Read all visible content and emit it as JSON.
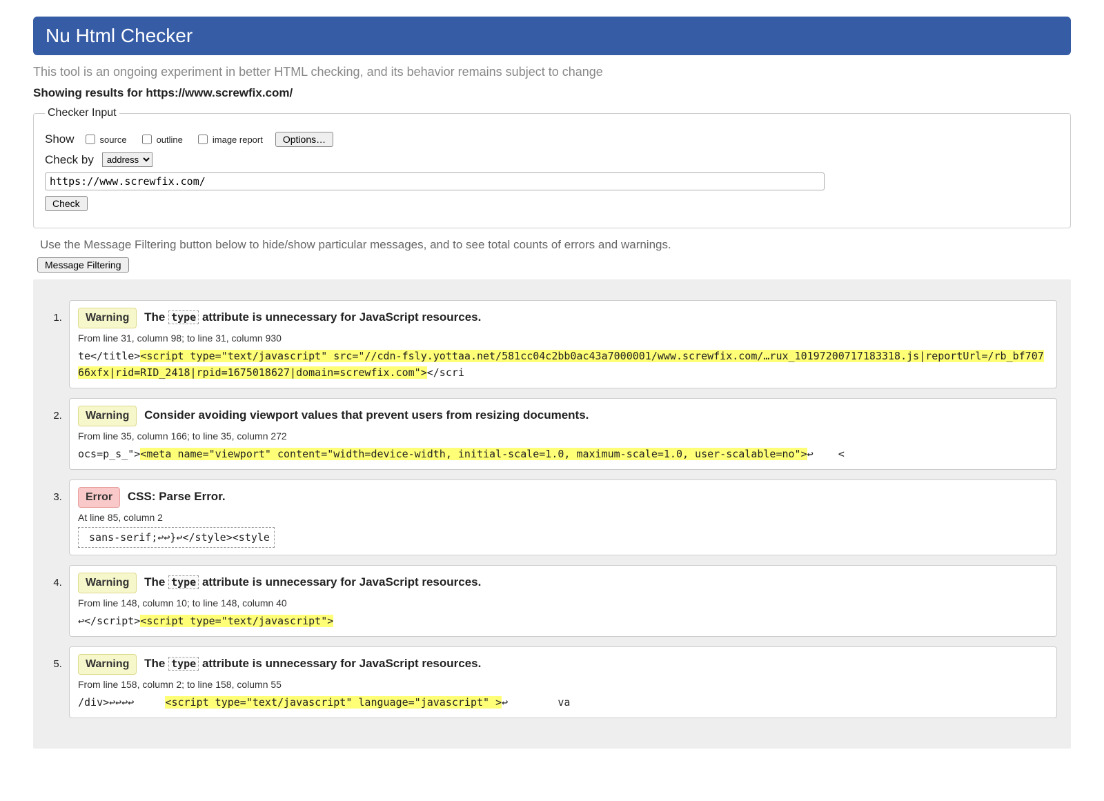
{
  "header": {
    "title": "Nu Html Checker"
  },
  "subtitle": "This tool is an ongoing experiment in better HTML checking, and its behavior remains subject to change",
  "showing_results_prefix": "Showing results for ",
  "showing_results_url": "https://www.screwfix.com/",
  "checker_input": {
    "legend": "Checker Input",
    "show_label": "Show",
    "cb_source": "source",
    "cb_outline": "outline",
    "cb_image_report": "image report",
    "options_btn": "Options…",
    "check_by_label": "Check by",
    "check_by_selected": "address",
    "url_value": "https://www.screwfix.com/",
    "check_btn": "Check"
  },
  "filter_note": "Use the Message Filtering button below to hide/show particular messages, and to see total counts of errors and warnings.",
  "message_filtering_btn": "Message Filtering",
  "badges": {
    "warning": "Warning",
    "error": "Error"
  },
  "messages": [
    {
      "type": "warning",
      "text_before_attr": "The ",
      "attr": "type",
      "text_after_attr": " attribute is unnecessary for JavaScript resources.",
      "location": "From line 31, column 98; to line 31, column 930",
      "extract_pre": "te</title>",
      "extract_hilite": "<script type=\"text/javascript\" src=\"//cdn-fsly.yottaa.net/581cc04c2bb0ac43a7000001/www.screwfix.com/…rux_10197200717183318.js|reportUrl=/rb_bf70766xfx|rid=RID_2418|rpid=1675018627|domain=screwfix.com\">",
      "extract_post": "</scri"
    },
    {
      "type": "warning",
      "text_plain": "Consider avoiding viewport values that prevent users from resizing documents.",
      "location": "From line 35, column 166; to line 35, column 272",
      "extract_pre": "ocs=p_s_\">",
      "extract_hilite": "<meta name=\"viewport\" content=\"width=device-width, initial-scale=1.0, maximum-scale=1.0, user-scalable=no\">",
      "extract_post": "↩    <"
    },
    {
      "type": "error",
      "text_plain": "CSS: Parse Error.",
      "location": "At line 85, column 2",
      "extract_boxed": " sans-serif;↩↩}↩</style><style"
    },
    {
      "type": "warning",
      "text_before_attr": "The ",
      "attr": "type",
      "text_after_attr": " attribute is unnecessary for JavaScript resources.",
      "location": "From line 148, column 10; to line 148, column 40",
      "extract_pre": "↩</script>",
      "extract_hilite": "<script type=\"text/javascript\">",
      "extract_post": ""
    },
    {
      "type": "warning",
      "text_before_attr": "The ",
      "attr": "type",
      "text_after_attr": " attribute is unnecessary for JavaScript resources.",
      "location": "From line 158, column 2; to line 158, column 55",
      "extract_pre": "/div>↩↩↩↩     ",
      "extract_hilite": "<script type=\"text/javascript\" language=\"javascript\" >",
      "extract_post": "↩        va"
    }
  ]
}
